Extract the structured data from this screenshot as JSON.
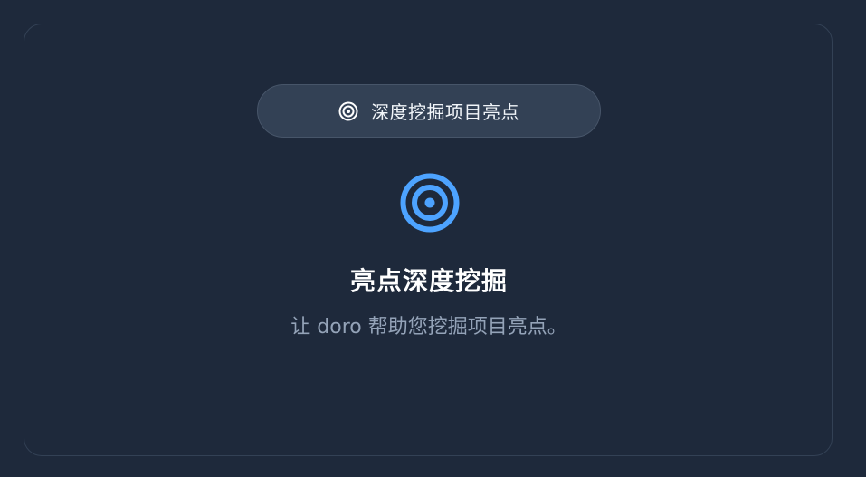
{
  "pill": {
    "icon": "target-icon",
    "label": "深度挖掘项目亮点"
  },
  "hero": {
    "icon": "target-icon",
    "title": "亮点深度挖掘",
    "subtitle": "让 doro 帮助您挖掘项目亮点。"
  },
  "colors": {
    "background": "#1e293b",
    "card_border": "#334155",
    "pill_bg": "#334155",
    "accent": "#4da3ff",
    "subtitle_text": "#94a3b8"
  }
}
